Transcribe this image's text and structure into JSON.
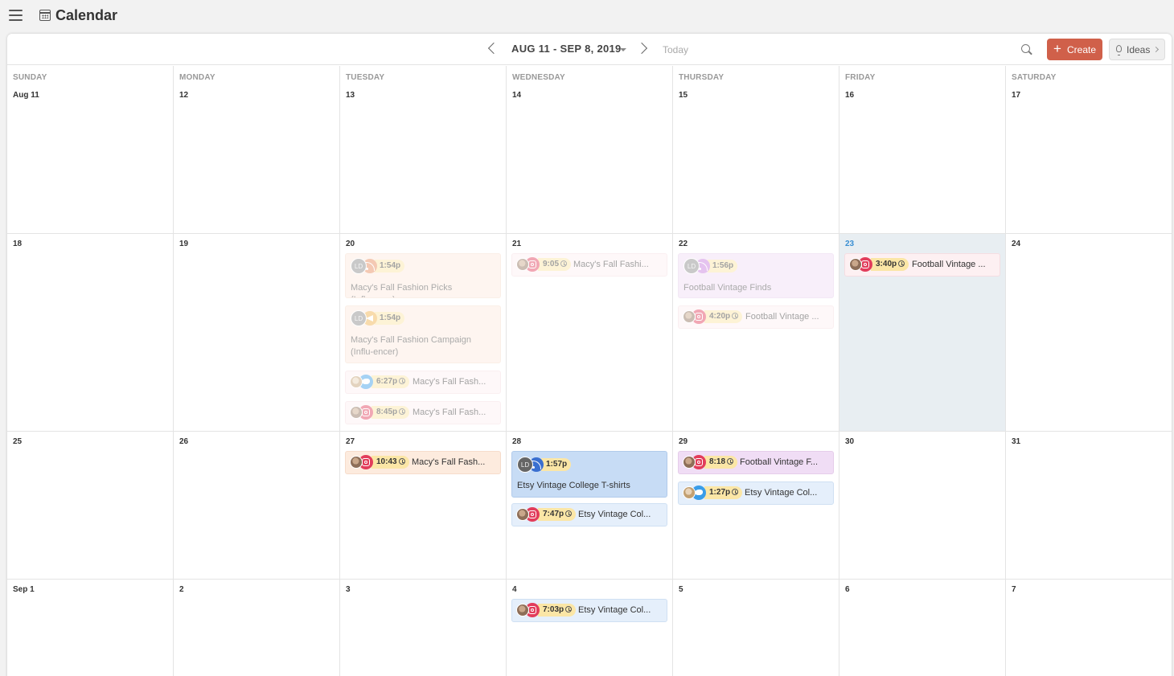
{
  "app": {
    "title": "Calendar"
  },
  "toolbar": {
    "range_label": "AUG 11 - SEP 8, 2019",
    "today_label": "Today",
    "create_label": "Create",
    "ideas_label": "Ideas"
  },
  "colors": {
    "accent": "#d0604a",
    "today_highlight": "#3a8fd3",
    "instagram": "#e23d5b",
    "twitter": "#3a9de8",
    "time_pill": "#fbe6a6"
  },
  "weekdays": [
    "SUNDAY",
    "MONDAY",
    "TUESDAY",
    "WEDNESDAY",
    "THURSDAY",
    "FRIDAY",
    "SATURDAY"
  ],
  "weeks": [
    [
      "Aug 11",
      "12",
      "13",
      "14",
      "15",
      "16",
      "17"
    ],
    [
      "18",
      "19",
      "20",
      "21",
      "22",
      "23",
      "24"
    ],
    [
      "25",
      "26",
      "27",
      "28",
      "29",
      "30",
      "31"
    ],
    [
      "Sep 1",
      "2",
      "3",
      "4",
      "5",
      "6",
      "7"
    ]
  ],
  "events": [
    {
      "day": "20",
      "time": "1:54p",
      "title": "",
      "body": "Macy's Fall Fashion Picks (Influencer)",
      "network": "rss-icon"
    },
    {
      "day": "20",
      "time": "1:54p",
      "title": "",
      "body": "Macy's Fall Fashion Campaign (Influ-encer)",
      "network": "megaphone-icon"
    },
    {
      "day": "20",
      "time": "6:27p",
      "title": "Macy's Fall Fash...",
      "network": "twitter-icon"
    },
    {
      "day": "20",
      "time": "8:45p",
      "title": "Macy's Fall Fash...",
      "network": "instagram-icon"
    },
    {
      "day": "21",
      "time": "9:05",
      "title": "Macy's Fall Fashi...",
      "network": "instagram-icon"
    },
    {
      "day": "22",
      "time": "1:56p",
      "title": "",
      "body": "Football Vintage Finds",
      "network": "rss-icon"
    },
    {
      "day": "22",
      "time": "4:20p",
      "title": "Football Vintage ...",
      "network": "instagram-icon"
    },
    {
      "day": "23",
      "time": "3:40p",
      "title": "Football Vintage ...",
      "network": "instagram-icon"
    },
    {
      "day": "27",
      "time": "10:43",
      "title": "Macy's Fall Fash...",
      "network": "instagram-icon"
    },
    {
      "day": "28",
      "time": "1:57p",
      "title": "",
      "body": "Etsy Vintage College T-shirts",
      "network": "rss-icon"
    },
    {
      "day": "28",
      "time": "7:47p",
      "title": "Etsy Vintage Col...",
      "network": "instagram-icon"
    },
    {
      "day": "29",
      "time": "8:18",
      "title": "Football Vintage F...",
      "network": "instagram-icon"
    },
    {
      "day": "29",
      "time": "1:27p",
      "title": "Etsy Vintage Col...",
      "network": "twitter-icon"
    },
    {
      "day": "4",
      "time": "7:03p",
      "title": "Etsy Vintage Col...",
      "network": "instagram-icon"
    }
  ],
  "ld_initials": "LD"
}
